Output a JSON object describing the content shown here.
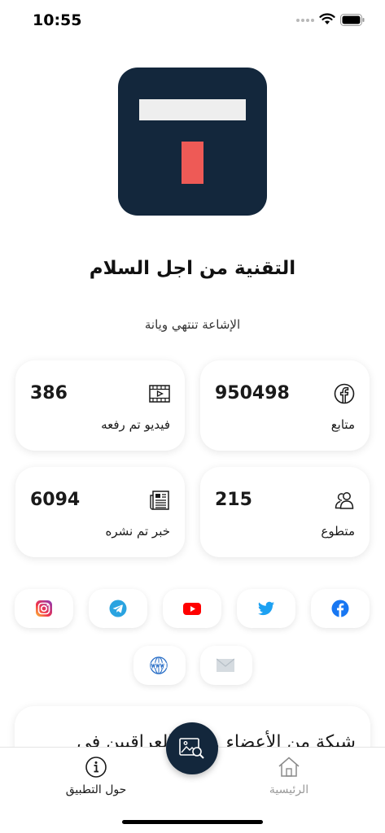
{
  "status_bar": {
    "time": "10:55"
  },
  "app": {
    "title": "التقنية من اجل السلام",
    "subtitle": "الإشاعة تنتهي ويانة"
  },
  "stats": [
    {
      "icon": "facebook-icon",
      "value": "950498",
      "label": "متابع"
    },
    {
      "icon": "video-icon",
      "value": "386",
      "label": "فيديو تم رفعه"
    },
    {
      "icon": "volunteers-icon",
      "value": "215",
      "label": "متطوع"
    },
    {
      "icon": "newspaper-icon",
      "value": "6094",
      "label": "خبر تم نشره"
    }
  ],
  "social_links": [
    "facebook-icon",
    "twitter-icon",
    "youtube-icon",
    "telegram-icon",
    "instagram-icon",
    "email-icon",
    "website-icon"
  ],
  "about": {
    "text": "شبكة من الأعضاء ...لين العراقيين في"
  },
  "tabs": {
    "home": "الرئيسية",
    "about": "حول التطبيق"
  },
  "colors": {
    "brand_navy": "#13273c",
    "brand_red": "#ee5a56",
    "facebook": "#1877f2",
    "twitter": "#1da1f2",
    "youtube": "#ff0000",
    "telegram": "#2aa3e0"
  }
}
